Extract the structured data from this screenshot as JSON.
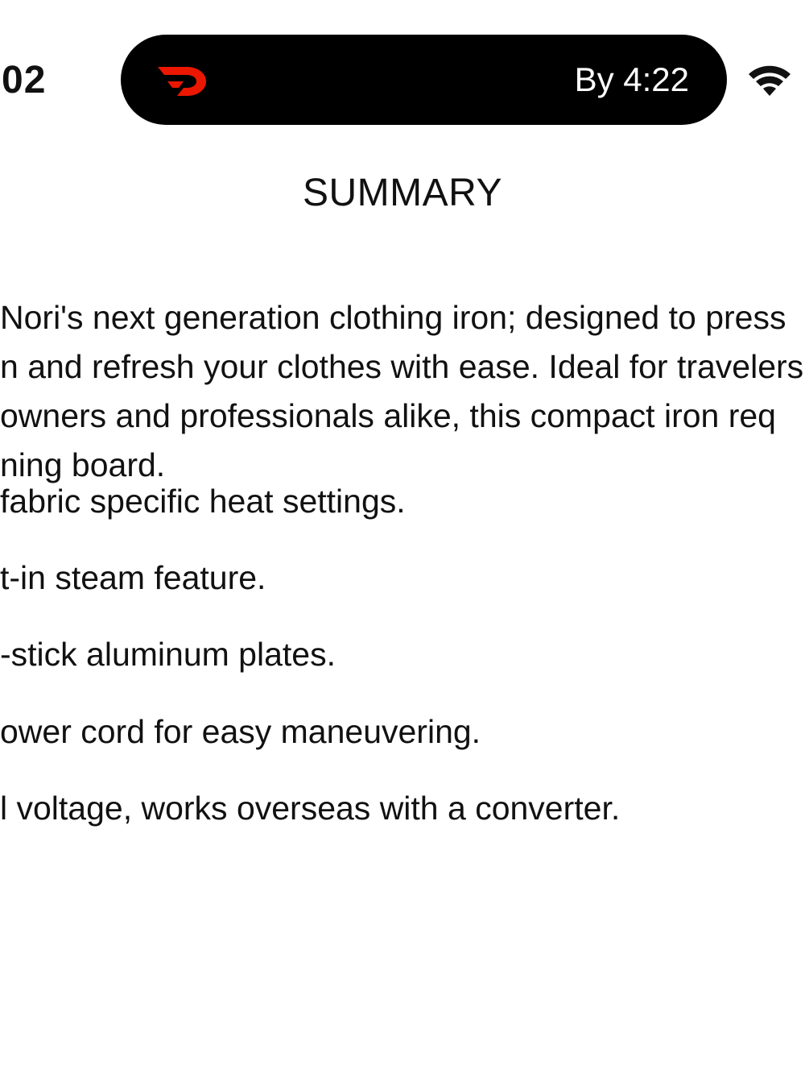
{
  "status_bar": {
    "time": "02",
    "eta": "By 4:22",
    "logo_icon": "doordash-logo-icon",
    "logo_color": "#eb1700",
    "wifi_icon": "wifi-icon"
  },
  "summary": {
    "title": "SUMMARY",
    "description_lines": [
      "Nori's next generation clothing iron; designed to press",
      "n and refresh your clothes with ease. Ideal for travelers",
      "owners and professionals alike, this compact iron req",
      "ning board."
    ],
    "features": [
      "fabric specific heat settings.",
      "t-in steam feature.",
      "-stick aluminum plates.",
      "ower cord for easy maneuvering.",
      "l voltage, works overseas with a converter."
    ]
  }
}
